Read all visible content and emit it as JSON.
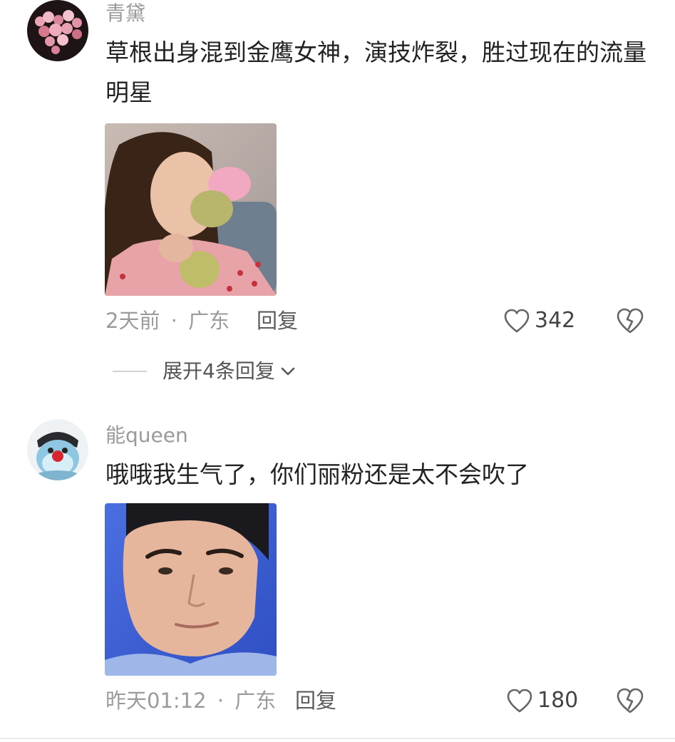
{
  "comments": [
    {
      "username": "青黛",
      "text": "草根出身混到金鹰女神，演技炸裂，胜过现在的流量明星",
      "time": "2天前",
      "separator": "·",
      "location": "广东",
      "reply_label": "回复",
      "like_count": "342",
      "expand_label": "展开4条回复"
    },
    {
      "username": "能queen",
      "text": "哦哦我生气了，你们丽粉还是太不会吹了",
      "time": "昨天01:12",
      "separator": "·",
      "location": "广东",
      "reply_label": "回复",
      "like_count": "180"
    }
  ],
  "colors": {
    "text": "#222222",
    "meta": "#9b9b9b",
    "icon": "#666666"
  },
  "icons": {
    "like": "heart-outline-icon",
    "dislike": "broken-heart-icon",
    "expand": "chevron-down-icon"
  }
}
